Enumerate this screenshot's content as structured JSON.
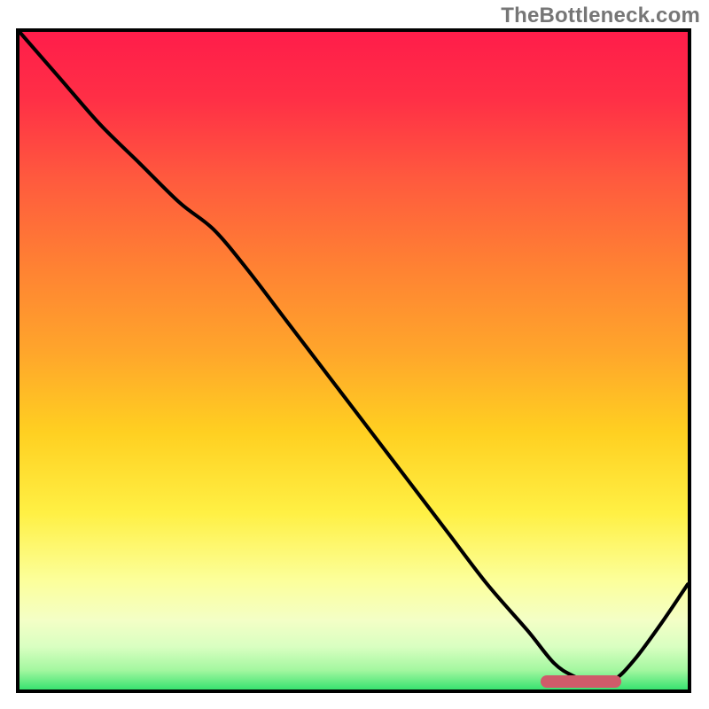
{
  "watermark": "TheBottleneck.com",
  "colors": {
    "frame": "#000000",
    "curve": "#000000",
    "indicator": "#cf5b6a",
    "gradient_stops": [
      {
        "offset": 0.0,
        "color": "#ff1d4a"
      },
      {
        "offset": 0.1,
        "color": "#ff2f46"
      },
      {
        "offset": 0.22,
        "color": "#ff5a3e"
      },
      {
        "offset": 0.35,
        "color": "#ff8133"
      },
      {
        "offset": 0.48,
        "color": "#ffa62b"
      },
      {
        "offset": 0.6,
        "color": "#ffd021"
      },
      {
        "offset": 0.72,
        "color": "#fff044"
      },
      {
        "offset": 0.82,
        "color": "#fcff9a"
      },
      {
        "offset": 0.88,
        "color": "#f4ffc6"
      },
      {
        "offset": 0.92,
        "color": "#d9ffc1"
      },
      {
        "offset": 0.955,
        "color": "#a4f7a0"
      },
      {
        "offset": 0.985,
        "color": "#35e26e"
      },
      {
        "offset": 1.0,
        "color": "#17d761"
      }
    ]
  },
  "chart_data": {
    "type": "line",
    "title": "",
    "xlabel": "",
    "ylabel": "",
    "xlim": [
      0,
      100
    ],
    "ylim": [
      0,
      100
    ],
    "grid": false,
    "series": [
      {
        "name": "bottleneck-curve",
        "x": [
          0,
          6,
          12,
          18,
          24,
          29,
          34,
          40,
          46,
          52,
          58,
          64,
          70,
          76,
          80,
          83,
          86,
          89,
          92,
          96,
          100
        ],
        "y": [
          100,
          93,
          86,
          80,
          74,
          70,
          64,
          56,
          48,
          40,
          32,
          24,
          16,
          9,
          4,
          2,
          1,
          1.5,
          4.5,
          10,
          16
        ]
      }
    ],
    "annotations": [
      {
        "name": "optimal-range-bar",
        "type": "hbar",
        "x_start": 78,
        "x_end": 90,
        "y": 1.2,
        "color": "#cf5b6a"
      }
    ]
  }
}
